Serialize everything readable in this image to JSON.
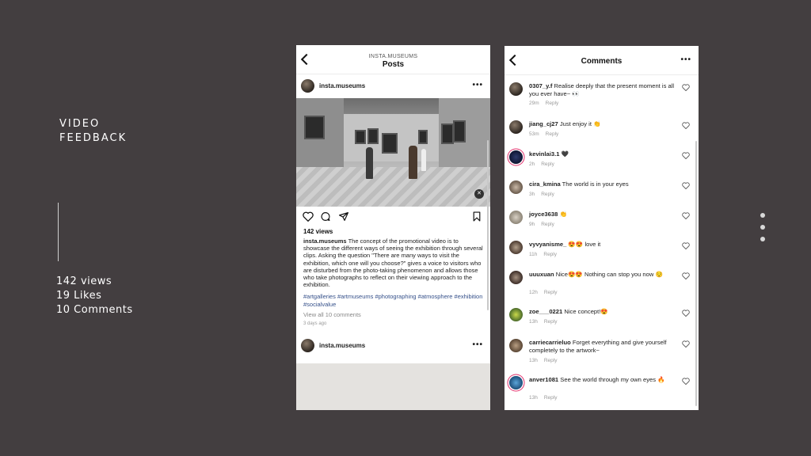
{
  "slide": {
    "title_line1": "VIDEO",
    "title_line2": "FEEDBACK",
    "stats": [
      "142 views",
      "19 Likes",
      "10 Comments"
    ]
  },
  "left_phone": {
    "header_sub": "INSTA.MUSEUMS",
    "header_title": "Posts",
    "post": {
      "username": "insta.museums",
      "views": "142 views",
      "caption_user": "insta.museums",
      "caption": "The concept of the promotional video is to showcase the different ways of seeing the exhibition through several clips. Asking the question \"There are many ways to visit the exhibition, which one will you choose?\" gives a voice to visitors who are disturbed from the photo-taking phenomenon and allows those who take photographs to reflect on their viewing approach to the exhibition.",
      "hashtags": "#artgalleries #artmuseums #photographing #atmosphere #exhibition #socialvalue",
      "view_all": "View all 10 comments",
      "time": "3 days ago"
    },
    "next_post_username": "insta.museums"
  },
  "right_phone": {
    "header_title": "Comments",
    "reply_label": "Reply",
    "comments": [
      {
        "user": "0307_y.f",
        "text": "Realise deeply that the present moment is all you ever have~ 👀",
        "time": "29m"
      },
      {
        "user": "jiang_cj27",
        "text": "Just enjoy it 👏",
        "time": "53m"
      },
      {
        "user": "kevinlai3.1",
        "text": "🖤",
        "time": "2h"
      },
      {
        "user": "cira_kmina",
        "text": "The world is in your eyes",
        "time": "3h"
      },
      {
        "user": "joyce3638",
        "text": "👏",
        "time": "9h"
      },
      {
        "user": "vyvyanisme_",
        "text": "😍😍 love it",
        "time": "11h"
      },
      {
        "user": "uuuxuan",
        "text": "Nice😍😍 Nothing can stop you now 😌",
        "time": "12h"
      },
      {
        "user": "zoe___0221",
        "text": "Nice concept!😍",
        "time": "13h"
      },
      {
        "user": "carriecarrieluo",
        "text": "Forget everything and give yourself completely to the artwork~",
        "time": "13h"
      },
      {
        "user": "anver1081",
        "text": "See the world through my own eyes 🔥",
        "time": "13h"
      }
    ]
  }
}
